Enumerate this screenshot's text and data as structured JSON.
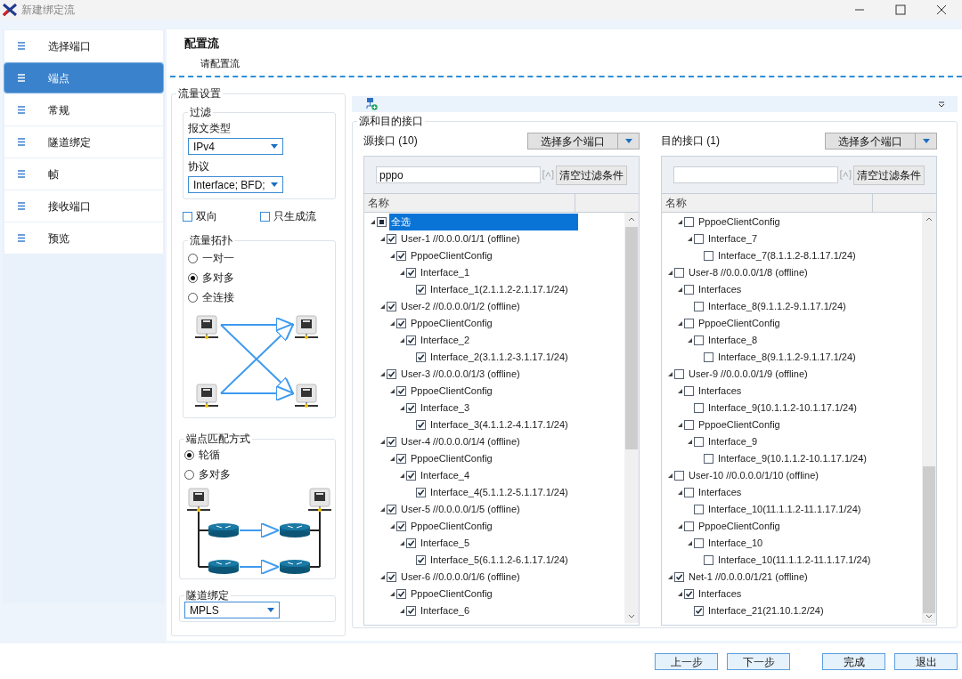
{
  "window": {
    "title": "新建绑定流"
  },
  "sidebar": {
    "items": [
      {
        "label": "选择端口",
        "selected": false
      },
      {
        "label": "端点",
        "selected": true
      },
      {
        "label": "常规",
        "selected": false
      },
      {
        "label": "隧道绑定",
        "selected": false
      },
      {
        "label": "帧",
        "selected": false
      },
      {
        "label": "接收端口",
        "selected": false
      },
      {
        "label": "预览",
        "selected": false
      }
    ]
  },
  "header": {
    "title": "配置流",
    "subtitle": "请配置流"
  },
  "traffic_settings": {
    "title": "流量设置",
    "filter": {
      "title": "过滤",
      "packet_type_label": "报文类型",
      "packet_type": "IPv4",
      "protocol_label": "协议",
      "protocol": "Interface; BFD;"
    },
    "options": [
      {
        "label": "双向",
        "checked": false
      },
      {
        "label": "只生成流",
        "checked": false
      }
    ],
    "topology": {
      "title": "流量拓扑",
      "options": [
        {
          "label": "一对一",
          "selected": false
        },
        {
          "label": "多对多",
          "selected": true
        },
        {
          "label": "全连接",
          "selected": false
        }
      ]
    },
    "endpoint_match": {
      "title": "端点匹配方式",
      "options": [
        {
          "label": "轮循",
          "selected": true
        },
        {
          "label": "多对多",
          "selected": false
        }
      ]
    },
    "tunnel_binding": {
      "title": "隧道绑定",
      "value": "MPLS"
    }
  },
  "interfaces": {
    "title": "源和目的接口",
    "panes": [
      {
        "label": "源接口 (10)",
        "select_button": "选择多个端口",
        "filter_value": "pppo",
        "clear_button": "清空过滤条件",
        "column": "名称",
        "tree": [
          {
            "label": "全选",
            "mixed": true,
            "selected": true,
            "children": [
              {
                "label": "User-1 //0.0.0.0/1/1 (offline)",
                "checked": true,
                "selected": false,
                "children": [
                  {
                    "label": "PppoeClientConfig",
                    "checked": true,
                    "selected": false,
                    "children": [
                      {
                        "label": "Interface_1",
                        "checked": true,
                        "selected": false,
                        "children": [
                          {
                            "label": "Interface_1(2.1.1.2-2.1.17.1/24)",
                            "checked": true,
                            "selected": false
                          }
                        ]
                      }
                    ]
                  }
                ]
              },
              {
                "label": "User-2 //0.0.0.0/1/2 (offline)",
                "checked": true,
                "selected": false,
                "children": [
                  {
                    "label": "PppoeClientConfig",
                    "checked": true,
                    "selected": false,
                    "children": [
                      {
                        "label": "Interface_2",
                        "checked": true,
                        "selected": false,
                        "children": [
                          {
                            "label": "Interface_2(3.1.1.2-3.1.17.1/24)",
                            "checked": true,
                            "selected": false
                          }
                        ]
                      }
                    ]
                  }
                ]
              },
              {
                "label": "User-3 //0.0.0.0/1/3 (offline)",
                "checked": true,
                "selected": false,
                "children": [
                  {
                    "label": "PppoeClientConfig",
                    "checked": true,
                    "selected": false,
                    "children": [
                      {
                        "label": "Interface_3",
                        "checked": true,
                        "selected": false,
                        "children": [
                          {
                            "label": "Interface_3(4.1.1.2-4.1.17.1/24)",
                            "checked": true,
                            "selected": false
                          }
                        ]
                      }
                    ]
                  }
                ]
              },
              {
                "label": "User-4 //0.0.0.0/1/4 (offline)",
                "checked": true,
                "selected": false,
                "children": [
                  {
                    "label": "PppoeClientConfig",
                    "checked": true,
                    "selected": false,
                    "children": [
                      {
                        "label": "Interface_4",
                        "checked": true,
                        "selected": false,
                        "children": [
                          {
                            "label": "Interface_4(5.1.1.2-5.1.17.1/24)",
                            "checked": true,
                            "selected": false
                          }
                        ]
                      }
                    ]
                  }
                ]
              },
              {
                "label": "User-5 //0.0.0.0/1/5 (offline)",
                "checked": true,
                "selected": false,
                "children": [
                  {
                    "label": "PppoeClientConfig",
                    "checked": true,
                    "selected": false,
                    "children": [
                      {
                        "label": "Interface_5",
                        "checked": true,
                        "selected": false,
                        "children": [
                          {
                            "label": "Interface_5(6.1.1.2-6.1.17.1/24)",
                            "checked": true,
                            "selected": false
                          }
                        ]
                      }
                    ]
                  }
                ]
              },
              {
                "label": "User-6 //0.0.0.0/1/6 (offline)",
                "checked": true,
                "selected": false,
                "children": [
                  {
                    "label": "PppoeClientConfig",
                    "checked": true,
                    "selected": false,
                    "children": [
                      {
                        "label": "Interface_6",
                        "checked": true,
                        "selected": false,
                        "has_children": true
                      }
                    ]
                  }
                ]
              }
            ]
          }
        ]
      },
      {
        "label": "目的接口 (1)",
        "select_button": "选择多个端口",
        "clear_button": "清空过滤条件",
        "column": "名称",
        "tree": [
          {
            "children": [
              {
                "label": "PppoeClientConfig",
                "checked": false,
                "selected": false,
                "children": [
                  {
                    "label": "Interface_7",
                    "checked": false,
                    "selected": false,
                    "children": [
                      {
                        "label": "Interface_7(8.1.1.2-8.1.17.1/24)",
                        "checked": false,
                        "selected": false
                      }
                    ]
                  }
                ]
              }
            ]
          },
          {
            "label": "User-8 //0.0.0.0/1/8 (offline)",
            "checked": false,
            "selected": false,
            "children": [
              {
                "label": "Interfaces",
                "checked": false,
                "selected": false,
                "children": [
                  {
                    "label": "Interface_8(9.1.1.2-9.1.17.1/24)",
                    "checked": false,
                    "selected": false
                  }
                ]
              },
              {
                "label": "PppoeClientConfig",
                "checked": false,
                "selected": false,
                "children": [
                  {
                    "label": "Interface_8",
                    "checked": false,
                    "selected": false,
                    "children": [
                      {
                        "label": "Interface_8(9.1.1.2-9.1.17.1/24)",
                        "checked": false,
                        "selected": false
                      }
                    ]
                  }
                ]
              }
            ]
          },
          {
            "label": "User-9 //0.0.0.0/1/9 (offline)",
            "checked": false,
            "selected": false,
            "children": [
              {
                "label": "Interfaces",
                "checked": false,
                "selected": false,
                "children": [
                  {
                    "label": "Interface_9(10.1.1.2-10.1.17.1/24)",
                    "checked": false,
                    "selected": false
                  }
                ]
              },
              {
                "label": "PppoeClientConfig",
                "checked": false,
                "selected": false,
                "children": [
                  {
                    "label": "Interface_9",
                    "checked": false,
                    "selected": false,
                    "children": [
                      {
                        "label": "Interface_9(10.1.1.2-10.1.17.1/24)",
                        "checked": false,
                        "selected": false
                      }
                    ]
                  }
                ]
              }
            ]
          },
          {
            "label": "User-10 //0.0.0.0/1/10 (offline)",
            "checked": false,
            "selected": false,
            "children": [
              {
                "label": "Interfaces",
                "checked": false,
                "selected": false,
                "children": [
                  {
                    "label": "Interface_10(11.1.1.2-11.1.17.1/24)",
                    "checked": false,
                    "selected": false
                  }
                ]
              },
              {
                "label": "PppoeClientConfig",
                "checked": false,
                "selected": false,
                "children": [
                  {
                    "label": "Interface_10",
                    "checked": false,
                    "selected": false,
                    "children": [
                      {
                        "label": "Interface_10(11.1.1.2-11.1.17.1/24)",
                        "checked": false,
                        "selected": false
                      }
                    ]
                  }
                ]
              }
            ]
          },
          {
            "label": "Net-1 //0.0.0.0/1/21 (offline)",
            "checked": true,
            "selected": false,
            "children": [
              {
                "label": "Interfaces",
                "checked": true,
                "selected": false,
                "children": [
                  {
                    "label": "Interface_21(21.10.1.2/24)",
                    "checked": true,
                    "selected": false
                  }
                ]
              }
            ]
          }
        ]
      }
    ]
  },
  "footer": {
    "buttons": [
      "上一步",
      "下一步",
      "完成",
      "退出"
    ]
  }
}
